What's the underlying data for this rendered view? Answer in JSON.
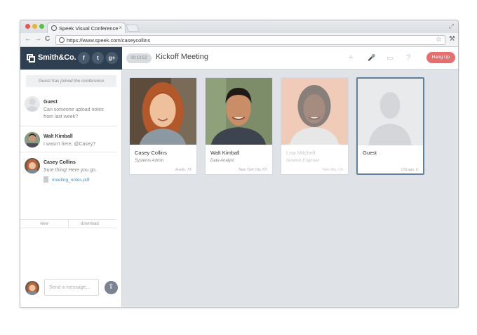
{
  "browser": {
    "tab_title": "Speek Visual Conference",
    "tab_close": "×",
    "url": "https://www.speek.com/caseycollins",
    "nav_back": "←",
    "nav_forward": "→",
    "nav_reload": "C",
    "star": "☆",
    "wrench": "⚒",
    "resize": "⤢"
  },
  "sidebar": {
    "brand": "Smith&Co.",
    "social": [
      "f",
      "t",
      "g+"
    ],
    "notice": "Guest has joined the conference",
    "messages": [
      {
        "name": "Guest",
        "text": "Can someone upload notes from last week?"
      },
      {
        "name": "Walt Kimball",
        "text": "I wasn't here, @Casey?"
      },
      {
        "name": "Casey Collins",
        "text": "Sure thing! Here you go.",
        "attachment": "meeting_notes.pdf"
      }
    ],
    "file_actions": [
      "view",
      "download"
    ],
    "composer_placeholder": "Send a message...",
    "send_icon": "⇪"
  },
  "meeting": {
    "timer": "00:13:52",
    "title": "Kickoff Meeting",
    "controls": [
      "+",
      "🎤",
      "▭",
      "?"
    ],
    "hangup": "Hang Up"
  },
  "participants": [
    {
      "name": "Casey Collins",
      "title": "Systems Admin",
      "location": "Austin, TX",
      "dimmed": false,
      "active": false
    },
    {
      "name": "Walt Kimball",
      "title": "Data Analyst",
      "location": "New York City, NY",
      "dimmed": false,
      "active": false
    },
    {
      "name": "Lisa Mitchell",
      "title": "Network Engineer",
      "location": "Palo Alto, CA",
      "dimmed": true,
      "active": false
    },
    {
      "name": "Guest",
      "title": "",
      "location": "Chicago, IL",
      "dimmed": false,
      "active": true
    }
  ],
  "colors": {
    "brand_bar": "#2f3f52",
    "hangup": "#e46f6f",
    "link": "#4a90c8",
    "main_bg": "#dfe3e8"
  }
}
